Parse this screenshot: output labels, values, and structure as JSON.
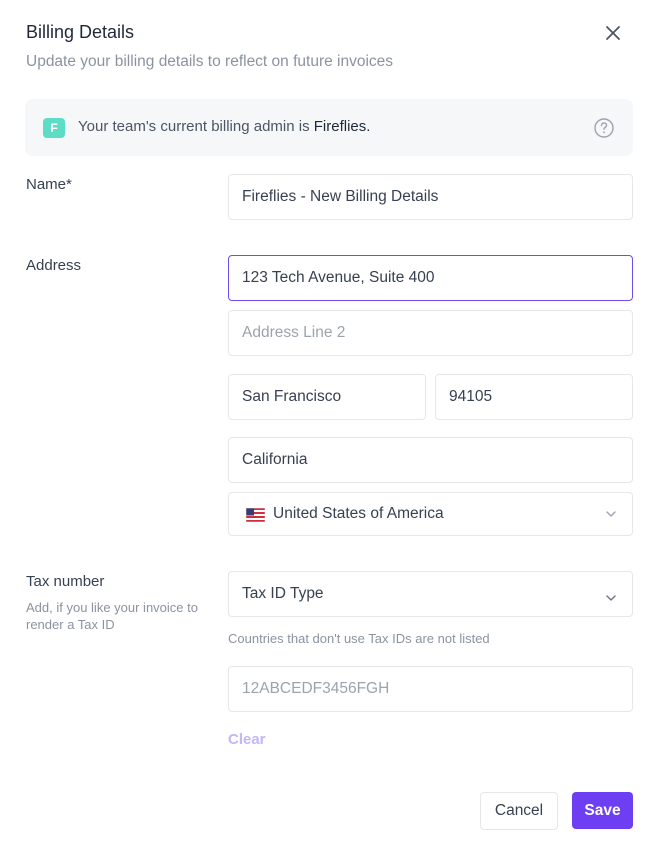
{
  "header": {
    "title": "Billing Details",
    "subtitle": "Update your billing details to reflect on future invoices"
  },
  "banner": {
    "avatar_letter": "F",
    "text_prefix": "Your team's current billing admin is ",
    "admin_name": "Fireflies."
  },
  "form": {
    "name": {
      "label": "Name*",
      "value": "Fireflies - New Billing Details"
    },
    "address": {
      "label": "Address",
      "line1": "123 Tech Avenue, Suite 400",
      "line2_placeholder": "Address Line 2",
      "city": "San Francisco",
      "zip": "94105",
      "state": "California",
      "country": "United States of America"
    },
    "tax": {
      "label": "Tax number",
      "hint": "Add, if you like your invoice to render a Tax ID",
      "type_placeholder": "Tax ID Type",
      "note": "Countries that don't use Tax IDs are not listed",
      "id_placeholder": "12ABCEDF3456FGH",
      "clear_label": "Clear"
    }
  },
  "actions": {
    "cancel_label": "Cancel",
    "save_label": "Save"
  },
  "colors": {
    "accent": "#6d3ef2",
    "focus_border": "#6d4df2",
    "avatar_bg": "#5ddcc6"
  }
}
